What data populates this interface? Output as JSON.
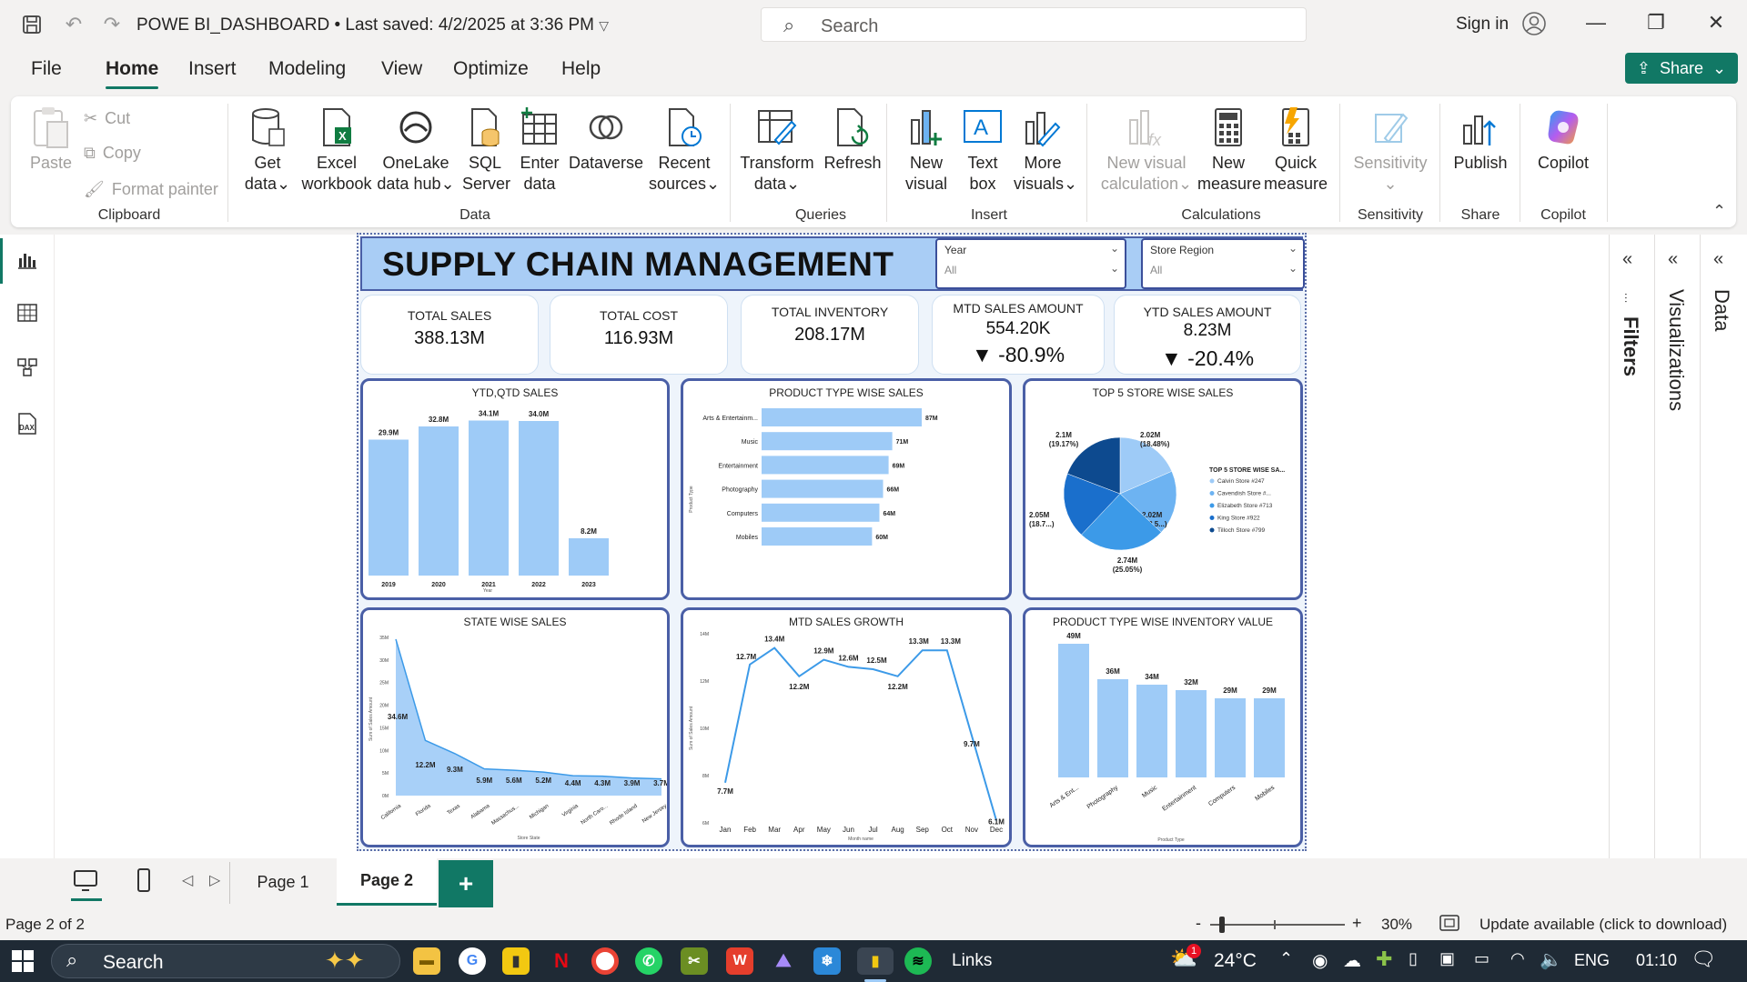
{
  "titlebar": {
    "title": "POWE BI_DASHBOARD • Last saved: 4/2/2025 at 3:36 PM",
    "search_placeholder": "Search",
    "sign_in": "Sign in"
  },
  "menu": {
    "items": [
      "File",
      "Home",
      "Insert",
      "Modeling",
      "View",
      "Optimize",
      "Help"
    ],
    "active": "Home",
    "share_label": "Share"
  },
  "ribbon": {
    "clipboard": {
      "paste": "Paste",
      "cut": "Cut",
      "copy": "Copy",
      "format_painter": "Format painter",
      "label": "Clipboard"
    },
    "data": {
      "get_data": [
        "Get",
        "data"
      ],
      "excel": [
        "Excel",
        "workbook"
      ],
      "onelake": [
        "OneLake",
        "data hub"
      ],
      "sql": [
        "SQL",
        "Server"
      ],
      "enter": [
        "Enter",
        "data"
      ],
      "dataverse": [
        "Dataverse",
        ""
      ],
      "recent": [
        "Recent",
        "sources"
      ],
      "label": "Data"
    },
    "queries": {
      "transform": [
        "Transform",
        "data"
      ],
      "refresh": [
        "Refresh",
        ""
      ],
      "label": "Queries"
    },
    "insert": {
      "new_visual": [
        "New",
        "visual"
      ],
      "text_box": [
        "Text",
        "box"
      ],
      "more_visuals": [
        "More",
        "visuals"
      ],
      "label": "Insert"
    },
    "calculations": {
      "new_visual_calc": [
        "New visual",
        "calculation"
      ],
      "new_measure": [
        "New",
        "measure"
      ],
      "quick_measure": [
        "Quick",
        "measure"
      ],
      "label": "Calculations"
    },
    "sensitivity": {
      "btn": "Sensitivity",
      "label": "Sensitivity"
    },
    "share": {
      "publish": "Publish",
      "label": "Share"
    },
    "copilot": {
      "btn": "Copilot",
      "label": "Copilot"
    }
  },
  "report": {
    "title": "SUPPLY CHAIN MANAGEMENT",
    "slicers": [
      {
        "label": "Year",
        "value": "All"
      },
      {
        "label": "Store Region",
        "value": "All"
      }
    ],
    "kpis": [
      {
        "title": "TOTAL SALES",
        "value": "388.13M"
      },
      {
        "title": "TOTAL COST",
        "value": "116.93M"
      },
      {
        "title": "TOTAL INVENTORY",
        "value": "208.17M"
      },
      {
        "title": "MTD SALES AMOUNT",
        "value": "554.20K",
        "delta": "▼ -80.9%"
      },
      {
        "title": "YTD SALES AMOUNT",
        "value": "8.23M",
        "delta": "▼ -20.4%"
      }
    ]
  },
  "chart_data": [
    {
      "type": "bar",
      "title": "YTD,QTD SALES",
      "xlabel": "Year",
      "ylabel": "",
      "categories": [
        "2019",
        "2020",
        "2021",
        "2022",
        "2023"
      ],
      "values": [
        29.9,
        32.8,
        34.1,
        34.0,
        8.2
      ],
      "labels": [
        "29.9M",
        "32.8M",
        "34.1M",
        "34.0M",
        "8.2M"
      ],
      "color": "#9ecbf7"
    },
    {
      "type": "bar",
      "orientation": "horizontal",
      "title": "PRODUCT TYPE WISE SALES",
      "ylabel": "Product Type",
      "categories": [
        "Arts & Entertainm...",
        "Music",
        "Entertainment",
        "Photography",
        "Computers",
        "Mobiles"
      ],
      "values": [
        87,
        71,
        69,
        66,
        64,
        60
      ],
      "labels": [
        "87M",
        "71M",
        "69M",
        "66M",
        "64M",
        "60M"
      ],
      "color": "#9ecbf7"
    },
    {
      "type": "pie",
      "title": "TOP 5 STORE WISE SALES",
      "legend_title": "TOP 5 STORE WISE SA...",
      "slices": [
        {
          "name": "Calvin Store #247",
          "value": 2.02,
          "label": "2.02M (18.48%)",
          "color": "#9ecbf7"
        },
        {
          "name": "Cavendish Store #...",
          "value": 2.02,
          "label": "2.02M (18.5...)",
          "color": "#6db3f2"
        },
        {
          "name": "Elizabeth Store #713",
          "value": 2.74,
          "label": "2.74M (25.05%)",
          "color": "#3c9ae8"
        },
        {
          "name": "King Store #922",
          "value": 2.05,
          "label": "2.05M (18.7...)",
          "color": "#1a6fcc"
        },
        {
          "name": "Tilloch Store #799",
          "value": 2.1,
          "label": "2.1M (19.17%)",
          "color": "#0d4a8f"
        }
      ],
      "legend": "right"
    },
    {
      "type": "area",
      "title": "STATE WISE SALES",
      "xlabel": "Store State",
      "ylabel": "Sum of Sales Amount",
      "categories": [
        "California",
        "Florida",
        "Texas",
        "Alabama",
        "Massachus...",
        "Michigan",
        "Virginia",
        "North Caro...",
        "Rhode Island",
        "New Jersey"
      ],
      "values": [
        34.6,
        12.2,
        9.3,
        5.9,
        5.6,
        5.2,
        4.4,
        4.3,
        3.9,
        3.7
      ],
      "labels": [
        "34.6M",
        "12.2M",
        "9.3M",
        "5.9M",
        "5.6M",
        "5.2M",
        "4.4M",
        "4.3M",
        "3.9M",
        "3.7M"
      ],
      "yticks": [
        "0M",
        "5M",
        "10M",
        "15M",
        "20M",
        "25M",
        "30M",
        "35M"
      ],
      "ylim": [
        0,
        35
      ],
      "color": "#9ecbf7"
    },
    {
      "type": "line",
      "title": "MTD SALES GROWTH",
      "xlabel": "Month name",
      "ylabel": "Sum of Sales Amount",
      "categories": [
        "Jan",
        "Feb",
        "Mar",
        "Apr",
        "May",
        "Jun",
        "Jul",
        "Aug",
        "Sep",
        "Oct",
        "Nov",
        "Dec"
      ],
      "values": [
        7.7,
        12.7,
        13.4,
        12.2,
        12.9,
        12.6,
        12.5,
        12.2,
        13.3,
        13.3,
        9.7,
        6.1
      ],
      "labels": [
        "7.7M",
        "12.7M",
        "13.4M",
        "12.2M",
        "12.9M",
        "12.6M",
        "12.5M",
        "12.2M",
        "13.3M",
        "13.3M",
        "9.7M",
        "6.1M"
      ],
      "yticks": [
        "6M",
        "8M",
        "10M",
        "12M",
        "14M"
      ],
      "ylim": [
        6,
        14
      ],
      "color": "#3c9ae8"
    },
    {
      "type": "bar",
      "title": "PRODUCT TYPE WISE INVENTORY VALUE",
      "xlabel": "Product Type",
      "categories": [
        "Arts & Ent...",
        "Photography",
        "Music",
        "Entertainment",
        "Computers",
        "Mobiles"
      ],
      "values": [
        49,
        36,
        34,
        32,
        29,
        29
      ],
      "labels": [
        "49M",
        "36M",
        "34M",
        "32M",
        "29M",
        "29M"
      ],
      "color": "#9ecbf7"
    }
  ],
  "right_panes": {
    "filters": "Filters",
    "visualizations": "Visualizations",
    "data": "Data"
  },
  "pages": {
    "tabs": [
      "Page 1",
      "Page 2"
    ],
    "active": "Page 2",
    "add": "+"
  },
  "statusbar": {
    "page": "Page 2 of 2",
    "zoom": "30%",
    "update": "Update available (click to download)"
  },
  "taskbar": {
    "search": "Search",
    "links": "Links",
    "weather": "24°C",
    "lang": "ENG",
    "time": "01:10",
    "badge": "1"
  }
}
